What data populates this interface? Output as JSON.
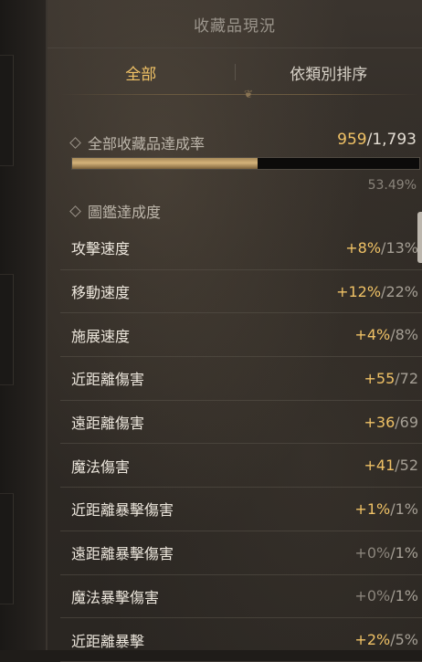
{
  "panel": {
    "title": "收藏品現況",
    "tabs": [
      {
        "label": "全部",
        "active": true
      },
      {
        "label": "依類別排序",
        "active": false
      }
    ]
  },
  "collection": {
    "label": "全部收藏品達成率",
    "current": "959",
    "total": "/1,793",
    "percent_text": "53.49%",
    "progress": 0.5349
  },
  "codex": {
    "label": "圖鑑達成度",
    "rows": [
      {
        "name": "攻擊速度",
        "bonus": "+8%",
        "max": "/13%",
        "zero": false
      },
      {
        "name": "移動速度",
        "bonus": "+12%",
        "max": "/22%",
        "zero": false
      },
      {
        "name": "施展速度",
        "bonus": "+4%",
        "max": "/8%",
        "zero": false
      },
      {
        "name": "近距離傷害",
        "bonus": "+55",
        "max": "/72",
        "zero": false
      },
      {
        "name": "遠距離傷害",
        "bonus": "+36",
        "max": "/69",
        "zero": false
      },
      {
        "name": "魔法傷害",
        "bonus": "+41",
        "max": "/52",
        "zero": false
      },
      {
        "name": "近距離暴擊傷害",
        "bonus": "+1%",
        "max": "/1%",
        "zero": false
      },
      {
        "name": "遠距離暴擊傷害",
        "bonus": "+0%",
        "max": "/1%",
        "zero": true
      },
      {
        "name": "魔法暴擊傷害",
        "bonus": "+0%",
        "max": "/1%",
        "zero": true
      },
      {
        "name": "近距離暴擊",
        "bonus": "+2%",
        "max": "/5%",
        "zero": false
      }
    ]
  },
  "colors": {
    "accent": "#f0c266",
    "text": "#ece6dc",
    "muted": "#8b857c",
    "background": "#2f2a25"
  }
}
